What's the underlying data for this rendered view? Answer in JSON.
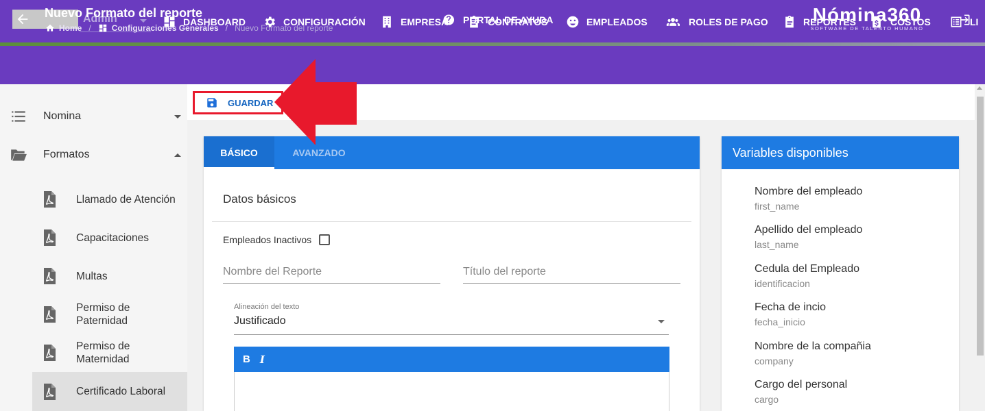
{
  "topnav": {
    "user": {
      "name": "Admin"
    },
    "items": [
      {
        "label": "DASHBOARD",
        "icon": "dashboard-icon"
      },
      {
        "label": "CONFIGURACIÓN",
        "icon": "gear-icon"
      },
      {
        "label": "EMPRESA",
        "icon": "building-icon"
      },
      {
        "label": "CONTRATOS",
        "icon": "clipboard-icon"
      },
      {
        "label": "EMPLEADOS",
        "icon": "face-icon"
      },
      {
        "label": "ROLES DE PAGO",
        "icon": "group-icon"
      },
      {
        "label": "REPORTES",
        "icon": "report-icon"
      },
      {
        "label": "COSTOS",
        "icon": "dollar-file-icon"
      },
      {
        "label": "LI",
        "icon": "list-icon"
      }
    ]
  },
  "header": {
    "title": "Nuevo Formato del reporte",
    "breadcrumb": {
      "home": "Home",
      "section": "Configuraciones Generales",
      "current": "Nuevo Formato del reporte"
    },
    "help_label": "PORTAL DE AYUDA",
    "brand_name": "Nómina360",
    "brand_tagline": "SOFTWARE DE TALENTO HUMANO"
  },
  "sidebar": {
    "items": [
      {
        "label": "Nomina",
        "icon": "list-icon",
        "expanded": false
      },
      {
        "label": "Formatos",
        "icon": "folder-open-icon",
        "expanded": true
      }
    ],
    "subitems": [
      {
        "label": "Llamado de Atención",
        "icon": "pdf-icon"
      },
      {
        "label": "Capacitaciones",
        "icon": "pdf-icon"
      },
      {
        "label": "Multas",
        "icon": "pdf-icon"
      },
      {
        "label": "Permiso de Paternidad",
        "line1": "Permiso de",
        "line2": "Paternidad",
        "icon": "pdf-icon"
      },
      {
        "label": "Permiso de Maternidad",
        "line1": "Permiso de",
        "line2": "Maternidad",
        "icon": "pdf-icon"
      },
      {
        "label": "Certificado Laboral",
        "icon": "pdf-icon",
        "active": true
      }
    ]
  },
  "toolbar": {
    "save_label": "GUARDAR"
  },
  "form": {
    "tabs": [
      {
        "label": "BÁSICO",
        "active": true
      },
      {
        "label": "AVANZADO",
        "active": false
      }
    ],
    "section_title": "Datos básicos",
    "inactive_label": "Empleados Inactivos",
    "inactive_checked": false,
    "report_name_placeholder": "Nombre del Reporte",
    "report_title_placeholder": "Título del reporte",
    "alignment_label": "Alineación del texto",
    "alignment_value": "Justificado",
    "editor": {
      "bold": "B",
      "italic": "I"
    }
  },
  "variables": {
    "title": "Variables disponibles",
    "items": [
      {
        "name": "Nombre del empleado",
        "key": "first_name"
      },
      {
        "name": "Apellido del empleado",
        "key": "last_name"
      },
      {
        "name": "Cedula del Empleado",
        "key": "identificacion"
      },
      {
        "name": "Fecha de incio",
        "key": "fecha_inicio"
      },
      {
        "name": "Nombre de la compañia",
        "key": "company"
      },
      {
        "name": "Cargo del personal",
        "key": "cargo"
      }
    ]
  },
  "colors": {
    "primary_purple": "#6a3bbf",
    "accent_blue": "#1e7be2",
    "highlight_red": "#e8192c"
  }
}
